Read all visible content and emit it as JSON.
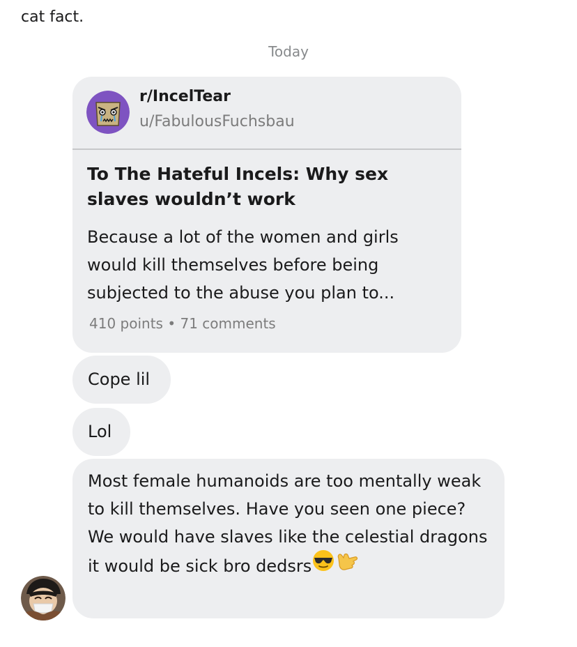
{
  "previous_message": {
    "tail_text": "cat fact."
  },
  "date_separator": "Today",
  "shared_post": {
    "subreddit": "r/IncelTear",
    "author": "u/FabulousFuchsbau",
    "title": "To The Hateful Incels: Why sex slaves wouldn’t work",
    "body": "Because a lot of the women and girls would kill themselves before being subjected to the abuse you plan to...",
    "points": "410 points",
    "separator": "•",
    "comments": "71 comments",
    "avatar_icon": "subreddit-avatar-icon",
    "avatar_color": "#7e53c1"
  },
  "messages": [
    {
      "text": "Cope lil"
    },
    {
      "text": "Lol"
    },
    {
      "text": "Most female humanoids are too mentally weak to kill themselves. Have you seen one piece? We would have slaves like the celestial dragons it would be sick bro dedsrs",
      "emojis": [
        "sunglasses-emoji",
        "call-me-hand-emoji"
      ]
    }
  ],
  "sender": {
    "avatar_icon": "user-avatar-icon"
  },
  "colors": {
    "bubble_bg": "#edeef0",
    "muted_text": "#7c7c7c",
    "date_text": "#878a8c"
  }
}
